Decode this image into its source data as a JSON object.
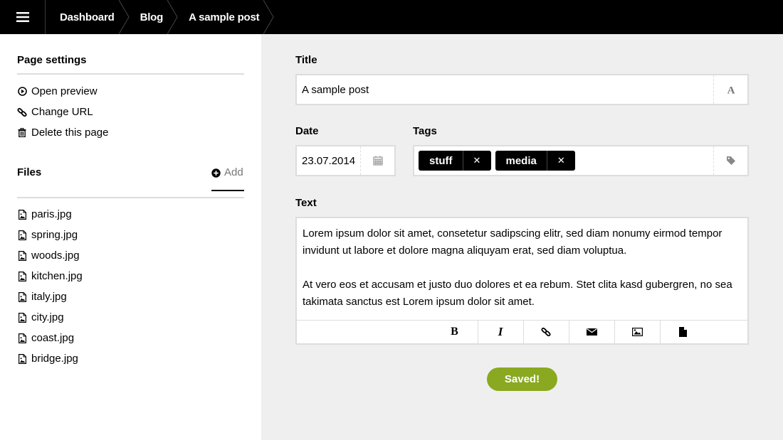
{
  "topbar": {
    "menu_icon": "hamburger-icon",
    "breadcrumbs": [
      "Dashboard",
      "Blog",
      "A sample post"
    ]
  },
  "sidebar": {
    "page_settings_title": "Page settings",
    "actions": [
      {
        "label": "Open preview",
        "icon": "play-circle-icon"
      },
      {
        "label": "Change URL",
        "icon": "link-icon"
      },
      {
        "label": "Delete this page",
        "icon": "trash-icon"
      }
    ],
    "files_title": "Files",
    "add_label": "Add",
    "files": [
      "paris.jpg",
      "spring.jpg",
      "woods.jpg",
      "kitchen.jpg",
      "italy.jpg",
      "city.jpg",
      "coast.jpg",
      "bridge.jpg"
    ]
  },
  "form": {
    "title_label": "Title",
    "title_value": "A sample post",
    "date_label": "Date",
    "date_value": "23.07.2014",
    "tags_label": "Tags",
    "tags": [
      "stuff",
      "media"
    ],
    "text_label": "Text",
    "text_paragraphs": [
      "Lorem ipsum dolor sit amet, consetetur sadipscing elitr, sed diam nonumy eirmod tempor invidunt ut labore et dolore magna aliquyam erat, sed diam voluptua.",
      "At vero eos et accusam et justo duo dolores et ea rebum. Stet clita kasd gubergren, no sea takimata sanctus est Lorem ipsum dolor sit amet."
    ],
    "toolbar": {
      "bold": "B",
      "italic": "I"
    },
    "save_label": "Saved!"
  },
  "colors": {
    "topbar_bg": "#000000",
    "main_bg": "#efefef",
    "save_green": "#8aa921"
  }
}
